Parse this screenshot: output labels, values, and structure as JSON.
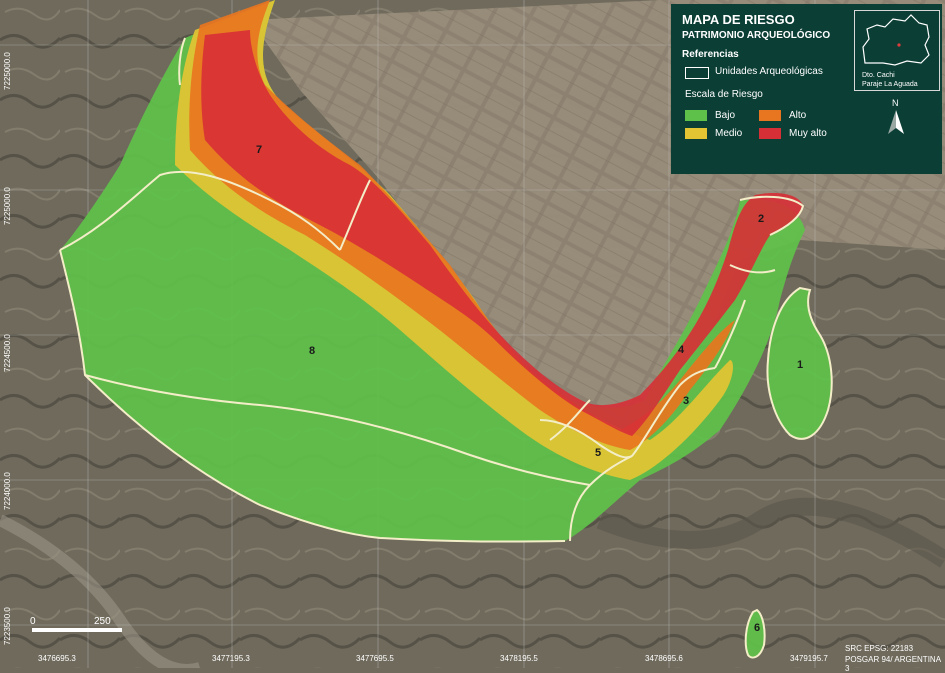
{
  "legend": {
    "title": "MAPA DE RIESGO",
    "subtitle": "PATRIMONIO ARQUEOLÓGICO",
    "references_heading": "Referencias",
    "units_label": "Unidades Arqueológicas",
    "scale_heading": "Escala de Riesgo",
    "levels": [
      {
        "label": "Bajo",
        "color": "#5ec24a"
      },
      {
        "label": "Medio",
        "color": "#e3c433"
      },
      {
        "label": "Alto",
        "color": "#e8751f"
      },
      {
        "label": "Muy alto",
        "color": "#d72f36"
      }
    ]
  },
  "inset": {
    "line1": "Dto. Cachi",
    "line2": "Paraje La Aguada"
  },
  "north_label": "N",
  "units": [
    "1",
    "2",
    "3",
    "4",
    "5",
    "6",
    "7",
    "8"
  ],
  "coordinates": {
    "x": [
      "3476695.3",
      "3477195.3",
      "3477695.5",
      "3478195.5",
      "3478695.6",
      "3479195.7"
    ],
    "y": [
      "7225000.0",
      "7225000.0",
      "7224500.0",
      "7224000.0",
      "7223500.0"
    ]
  },
  "scale": {
    "zero": "0",
    "mark": "250"
  },
  "crs": {
    "line1": "SRC EPSG: 22183",
    "line2": "POSGAR 94/ ARGENTINA 3"
  },
  "colors": {
    "terrain": "#6f6a5c",
    "fields": "#8f8372",
    "legend_bg": "#0b3e35",
    "unit_outline": "#f3edc8"
  }
}
